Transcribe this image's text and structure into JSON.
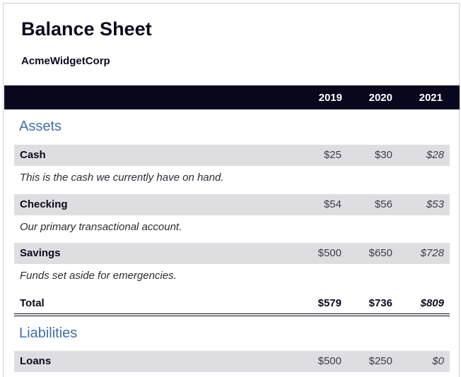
{
  "report": {
    "title": "Balance Sheet",
    "company": "AcmeWidgetCorp"
  },
  "years": [
    "2019",
    "2020",
    "2021"
  ],
  "assets": {
    "heading": "Assets",
    "items": [
      {
        "label": "Cash",
        "values": [
          "$25",
          "$30",
          "$28"
        ],
        "description": "This is the cash we currently have on hand."
      },
      {
        "label": "Checking",
        "values": [
          "$54",
          "$56",
          "$53"
        ],
        "description": "Our primary transactional account."
      },
      {
        "label": "Savings",
        "values": [
          "$500",
          "$650",
          "$728"
        ],
        "description": "Funds set aside for emergencies."
      }
    ],
    "total": {
      "label": "Total",
      "values": [
        "$579",
        "$736",
        "$809"
      ]
    }
  },
  "liabilities": {
    "heading": "Liabilities",
    "items": [
      {
        "label": "Loans",
        "values": [
          "$500",
          "$250",
          "$0"
        ]
      }
    ]
  },
  "colors": {
    "header_bg": "#07071e",
    "section_heading": "#3e70a8",
    "row_shade": "#dedee2"
  }
}
